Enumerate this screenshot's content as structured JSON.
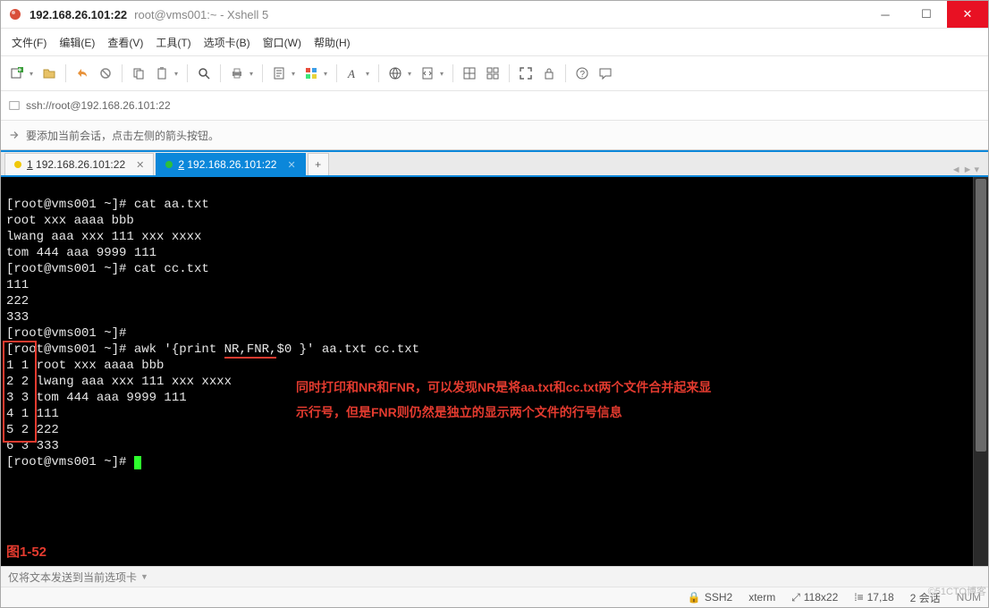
{
  "title": {
    "host": "192.168.26.101:22",
    "sub": "root@vms001:~ - Xshell 5"
  },
  "menu": {
    "file": "文件(F)",
    "edit": "编辑(E)",
    "view": "查看(V)",
    "tools": "工具(T)",
    "tabs": "选项卡(B)",
    "window": "窗口(W)",
    "help": "帮助(H)"
  },
  "address": {
    "url": "ssh://root@192.168.26.101:22"
  },
  "hint": {
    "text": "要添加当前会话，点击左侧的箭头按钮。"
  },
  "tabs": {
    "t1": "1 192.168.26.101:22",
    "t2": "2 192.168.26.101:22",
    "add": "+"
  },
  "terminal": {
    "l01": "[root@vms001 ~]# cat aa.txt",
    "l02": "root xxx aaaa bbb",
    "l03": "lwang aaa xxx 111 xxx xxxx",
    "l04": "tom 444 aaa 9999 111",
    "l05": "[root@vms001 ~]# cat cc.txt",
    "l06": "111",
    "l07": "222",
    "l08": "333",
    "l09": "[root@vms001 ~]#",
    "l10a": "[root@vms001 ~]# awk '{print ",
    "l10b": "NR,FNR,",
    "l10c": "$0 }' aa.txt cc.txt",
    "l11": "1 1 root xxx aaaa bbb",
    "l12": "2 2 lwang aaa xxx 111 xxx xxxx",
    "l13": "3 3 tom 444 aaa 9999 111",
    "l14": "4 1 111",
    "l15": "5 2 222",
    "l16": "6 3 333",
    "l17": "[root@vms001 ~]# ",
    "ann1": "同时打印和NR和FNR，可以发现NR是将aa.txt和cc.txt两个文件合并起来显",
    "ann2": "示行号，但是FNR则仍然是独立的显示两个文件的行号信息",
    "fig": "图1-52"
  },
  "footer": {
    "send": "仅将文本发送到当前选项卡"
  },
  "status": {
    "proto": "SSH2",
    "term": "xterm",
    "size": "118x22",
    "pos": "17,18",
    "sess": "2 会话",
    "wm": "©51CTO博客",
    "caps": "NUM"
  },
  "colors": {
    "accent": "#0b87da",
    "danger": "#e81123",
    "highlight": "#e43b2f"
  }
}
